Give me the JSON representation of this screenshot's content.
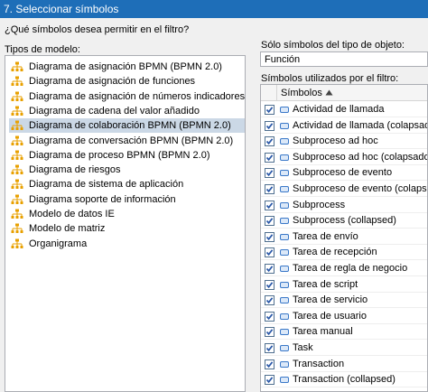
{
  "window": {
    "title": "7. Seleccionar símbolos"
  },
  "question": "¿Qué símbolos desea permitir en el filtro?",
  "model_types": {
    "label": "Tipos de modelo:",
    "selected_index": 4,
    "items": [
      "Diagrama de asignación BPMN (BPMN 2.0)",
      "Diagrama de asignación de funciones",
      "Diagrama de asignación de números indicadores",
      "Diagrama de cadena del valor añadido",
      "Diagrama de colaboración BPMN (BPMN 2.0)",
      "Diagrama de conversación BPMN (BPMN 2.0)",
      "Diagrama de proceso BPMN (BPMN 2.0)",
      "Diagrama de riesgos",
      "Diagrama de sistema de aplicación",
      "Diagrama soporte de información",
      "Modelo de datos IE",
      "Modelo de matriz",
      "Organigrama"
    ]
  },
  "object_type": {
    "label": "Sólo símbolos del tipo de objeto:",
    "value": "Función"
  },
  "symbols": {
    "label": "Símbolos utilizados por el filtro:",
    "column_header": "Símbolos",
    "items": [
      {
        "label": "Actividad de llamada",
        "checked": true
      },
      {
        "label": "Actividad de llamada (colapsado)",
        "checked": true
      },
      {
        "label": "Subproceso ad hoc",
        "checked": true
      },
      {
        "label": "Subproceso ad hoc (colapsado)",
        "checked": true
      },
      {
        "label": "Subproceso de evento",
        "checked": true
      },
      {
        "label": "Subproceso de evento (colapsado)",
        "checked": true
      },
      {
        "label": "Subprocess",
        "checked": true
      },
      {
        "label": "Subprocess (collapsed)",
        "checked": true
      },
      {
        "label": "Tarea de envío",
        "checked": true
      },
      {
        "label": "Tarea de recepción",
        "checked": true
      },
      {
        "label": "Tarea de regla de negocio",
        "checked": true
      },
      {
        "label": "Tarea de script",
        "checked": true
      },
      {
        "label": "Tarea de servicio",
        "checked": true
      },
      {
        "label": "Tarea de usuario",
        "checked": true
      },
      {
        "label": "Tarea manual",
        "checked": true
      },
      {
        "label": "Task",
        "checked": true
      },
      {
        "label": "Transaction",
        "checked": true
      },
      {
        "label": "Transaction (collapsed)",
        "checked": true
      }
    ]
  },
  "colors": {
    "title_bar": "#1e6eb8",
    "selection": "#cbd8e6",
    "model_icon": "#e8a000",
    "symbol_icon": "#3a78c8",
    "check": "#2a58a8"
  }
}
